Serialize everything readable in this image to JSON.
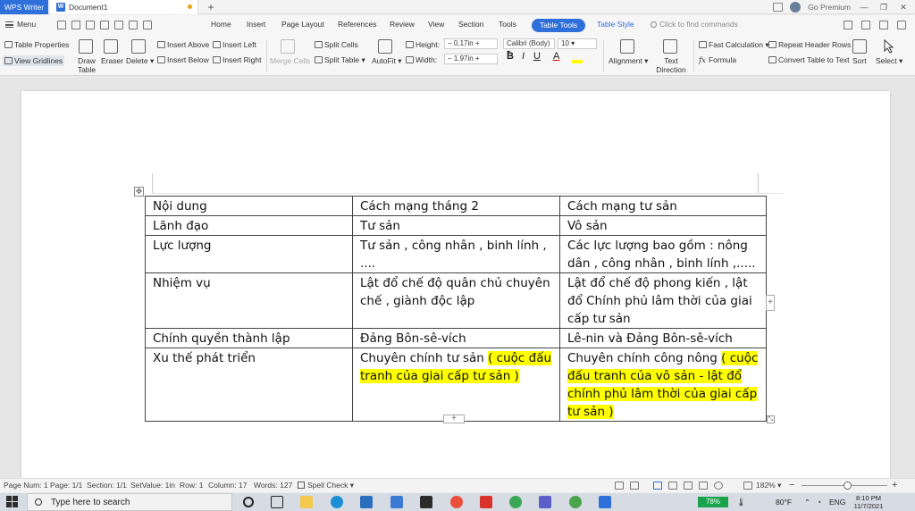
{
  "titlebar": {
    "app_name": "WPS Writer",
    "doc_tab": "Document1",
    "new_tab": "+",
    "premium": "Go Premium",
    "min": "—",
    "restore": "❐",
    "close": "✕"
  },
  "menu": {
    "menu_label": "Menu",
    "tabs": [
      "Home",
      "Insert",
      "Page Layout",
      "References",
      "Review",
      "View",
      "Section",
      "Tools"
    ],
    "table_tools": "Table Tools",
    "table_style": "Table Style",
    "find_placeholder": "Click to find commands"
  },
  "toolbar": {
    "table_properties": "Table Properties",
    "view_gridlines": "View Gridlines",
    "draw_table": "Draw Table",
    "eraser": "Eraser",
    "delete": "Delete",
    "insert_above": "Insert Above",
    "insert_below": "Insert Below",
    "insert_left": "Insert Left",
    "insert_right": "Insert Right",
    "merge_cells": "Merge Cells",
    "split_cells": "Split Cells",
    "split_table": "Split Table",
    "autofit": "AutoFit",
    "height_label": "Height:",
    "height_value": "0.17in",
    "width_label": "Width:",
    "width_value": "1.97in",
    "font_name": "Calibri (Body)",
    "font_size": "10",
    "bold": "B",
    "italic": "I",
    "underline": "U",
    "font_color": "A",
    "alignment": "Alignment",
    "text_direction": "Text Direction",
    "fast_calculation": "Fast Calculation",
    "formula": "Formula",
    "repeat_header_rows": "Repeat Header Rows",
    "convert_table_to_text": "Convert Table to Text",
    "sort": "Sort",
    "select": "Select"
  },
  "document": {
    "table": {
      "rows": [
        [
          "Nội dung",
          "Cách mạng tháng 2",
          "Cách mạng tư sản"
        ],
        [
          "Lãnh đạo",
          "Tư sản",
          "Vô sản"
        ],
        [
          "Lực lượng",
          "Tư sản , công nhân , binh lính , ....",
          "Các lực lượng bao gồm : nông dân , công nhân , binh lính ,....."
        ],
        [
          "Nhiệm vụ",
          "Lật đổ chế độ quân chủ chuyên chế , giành độc lập",
          "Lật đổ chế độ phong kiến , lật đổ Chính phủ lâm thời của giai cấp tư sản"
        ],
        [
          "Chính quyền thành lập",
          "Đảng Bôn-sê-vích",
          "Lê-nin và Đảng Bôn-sê-vích"
        ]
      ],
      "last_row": {
        "c1": "Xu thế phát triển",
        "c2_plain": "Chuyên chính tư sản ",
        "c2_highlight": "( cuộc đấu tranh của giai cấp tư sản )",
        "c3_plain": "Chuyên chính công nông ",
        "c3_highlight": "( cuộc đấu tranh của vô sản - lật đổ chính phủ lâm thời của giai cấp tư sản )"
      }
    },
    "highlight_color": "#ffff00"
  },
  "statusbar": {
    "page_num": "Page Num: 1",
    "page": "Page: 1/1",
    "section": "Section: 1/1",
    "setvalue": "SetValue: 1in",
    "row": "Row: 1",
    "column": "Column: 17",
    "words": "Words: 127",
    "spell_check": "Spell Check",
    "zoom": "182%",
    "zoom_minus": "−",
    "zoom_plus": "+"
  },
  "taskbar": {
    "search_placeholder": "Type here to search",
    "battery": "78%",
    "temperature": "80°F",
    "language": "ENG",
    "time": "8:10 PM",
    "date": "11/7/2021"
  },
  "colors": {
    "accent": "#2f6fd9",
    "battery": "#19a34a"
  }
}
